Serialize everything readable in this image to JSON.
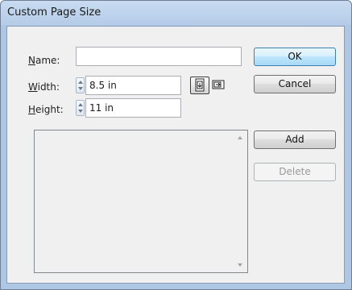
{
  "window": {
    "title": "Custom Page Size"
  },
  "form": {
    "name": {
      "label_underline": "N",
      "label_rest": "ame:",
      "value": ""
    },
    "width": {
      "label_underline": "W",
      "label_rest": "idth:",
      "value": "8.5 in"
    },
    "height": {
      "label_underline": "H",
      "label_rest": "eight:",
      "value": "11 in"
    }
  },
  "orientation": {
    "selected": "portrait"
  },
  "buttons": {
    "ok": "OK",
    "cancel": "Cancel",
    "add": "Add",
    "delete": "Delete"
  },
  "page_size_list": {
    "items": []
  },
  "colors": {
    "title_bar": "#b5cce8",
    "dialog_bg": "#f0f0f0",
    "default_button": "#bee6fd"
  }
}
